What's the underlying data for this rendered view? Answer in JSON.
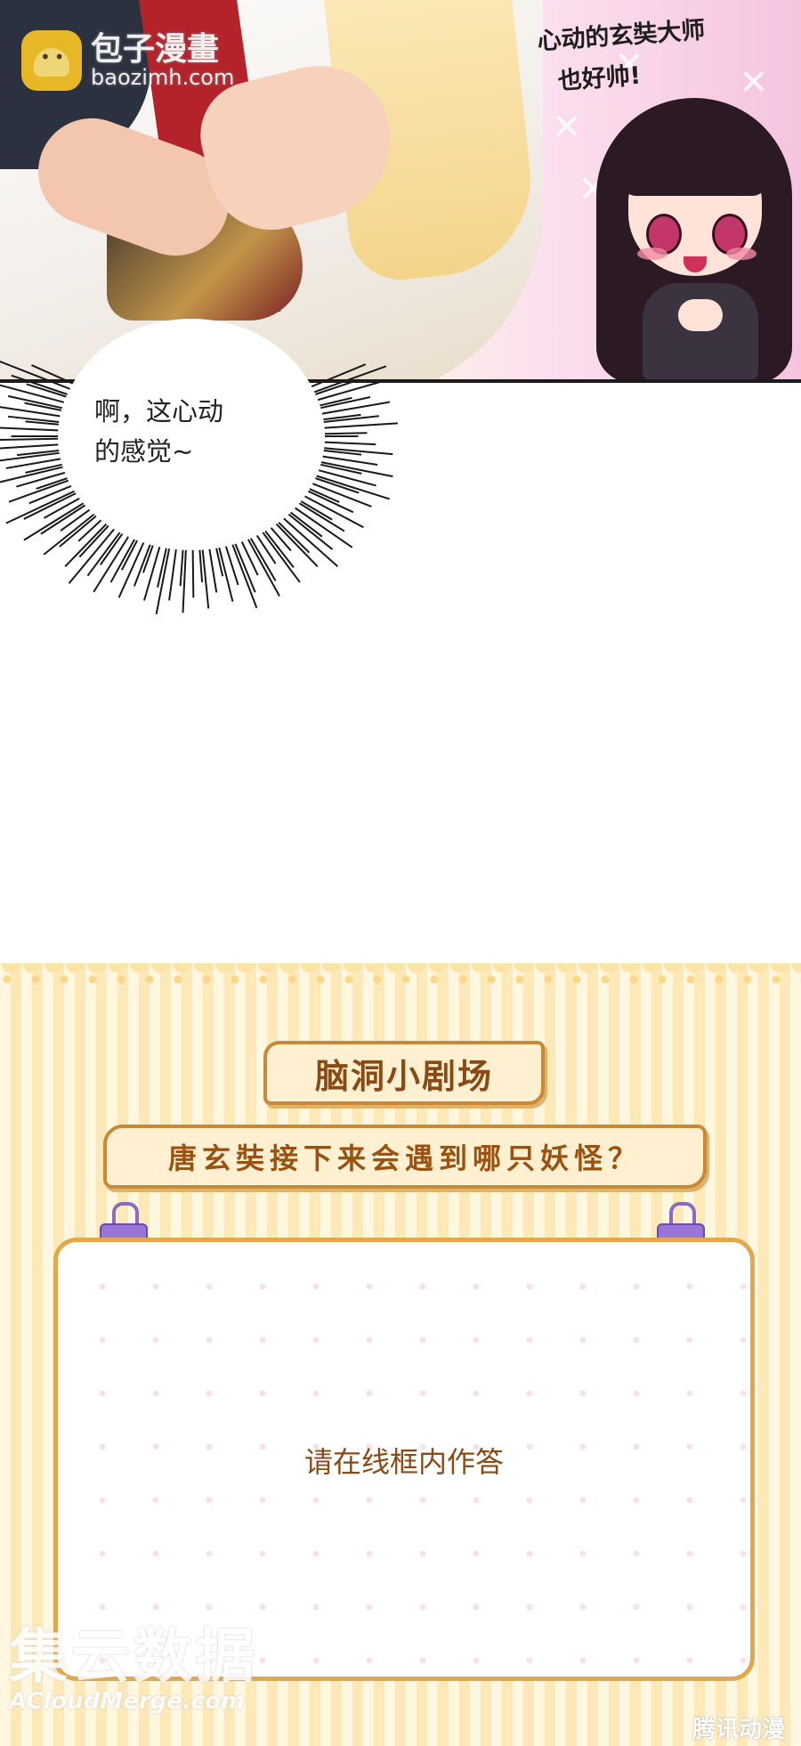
{
  "panel_top": {
    "speech_lines": [
      "心动的玄奘大师",
      "也好帅!"
    ]
  },
  "burst_bubble": {
    "lines": [
      "啊，这心动",
      "的感觉~"
    ]
  },
  "watermark_top": {
    "name": "包子漫畫",
    "url": "baozimh.com"
  },
  "quiz": {
    "title": "脑洞小剧场",
    "question": "唐玄奘接下来会遇到哪只妖怪？",
    "answer_placeholder": "请在线框内作答"
  },
  "watermark_bottom": {
    "cn": "集云数据",
    "en": "ACloudMerge.com",
    "right_logo": "腾讯动漫"
  }
}
